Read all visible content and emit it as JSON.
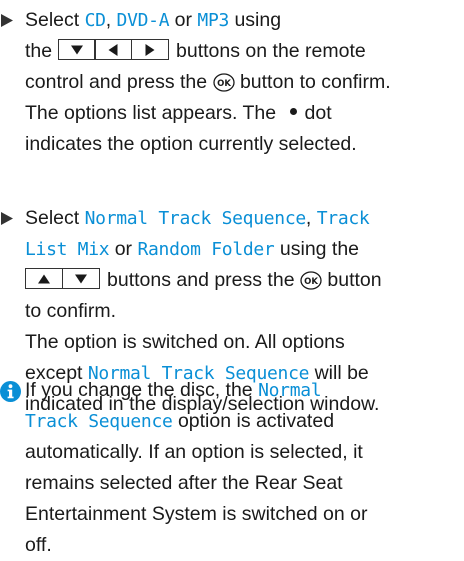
{
  "step1": {
    "lines": [
      {
        "parts": [
          "Select ",
          {
            "kw": "CD"
          },
          ", ",
          {
            "kw": "DVD-A"
          },
          " or ",
          {
            "kw": "MP3"
          },
          " using"
        ]
      },
      {
        "parts": [
          "the ",
          {
            "buttons": [
              "down",
              "left",
              "right"
            ]
          },
          "buttons on the remote"
        ]
      },
      {
        "parts": [
          "control and press the ",
          {
            "ok": true
          },
          " button to confirm."
        ]
      },
      {
        "parts": [
          "The options list appears. The ",
          {
            "dot": true
          },
          "dot"
        ]
      },
      {
        "parts": [
          "indicates the option currently selected."
        ]
      }
    ]
  },
  "step2": {
    "lines": [
      {
        "parts": [
          "Select ",
          {
            "kw": "Normal Track Sequence"
          },
          ", ",
          {
            "kw": "Track"
          }
        ]
      },
      {
        "parts": [
          {
            "kw": "List Mix"
          },
          " or ",
          {
            "kw": "Random Folder"
          },
          " using the"
        ]
      },
      {
        "parts": [
          {
            "buttons": [
              "up",
              "down"
            ]
          },
          "buttons and press the ",
          {
            "ok": true
          },
          " button"
        ]
      },
      {
        "parts": [
          "to confirm."
        ]
      },
      {
        "parts": [
          "The option is switched on. All options"
        ]
      },
      {
        "parts": [
          "except ",
          {
            "kw": "Normal Track Sequence"
          },
          " will be"
        ]
      },
      {
        "parts": [
          "indicated in the display/selection window."
        ]
      }
    ]
  },
  "note": {
    "lines": [
      {
        "parts": [
          "If you change the disc, the ",
          {
            "kw": "Normal"
          }
        ]
      },
      {
        "parts": [
          {
            "kw": "Track Sequence"
          },
          " option is activated"
        ]
      },
      {
        "parts": [
          "automatically. If an option is selected, it"
        ]
      },
      {
        "parts": [
          "remains selected after the Rear Seat"
        ]
      },
      {
        "parts": [
          "Entertainment System is switched on or"
        ]
      },
      {
        "parts": [
          "off."
        ]
      }
    ]
  },
  "colors": {
    "keyword": "#0a8fd6",
    "info": "#0a8fd6",
    "text": "#1a1a1a"
  },
  "icons": {
    "bullet": "right-triangle-icon",
    "info": "info-circle-icon",
    "ok": "ok-button-icon"
  }
}
